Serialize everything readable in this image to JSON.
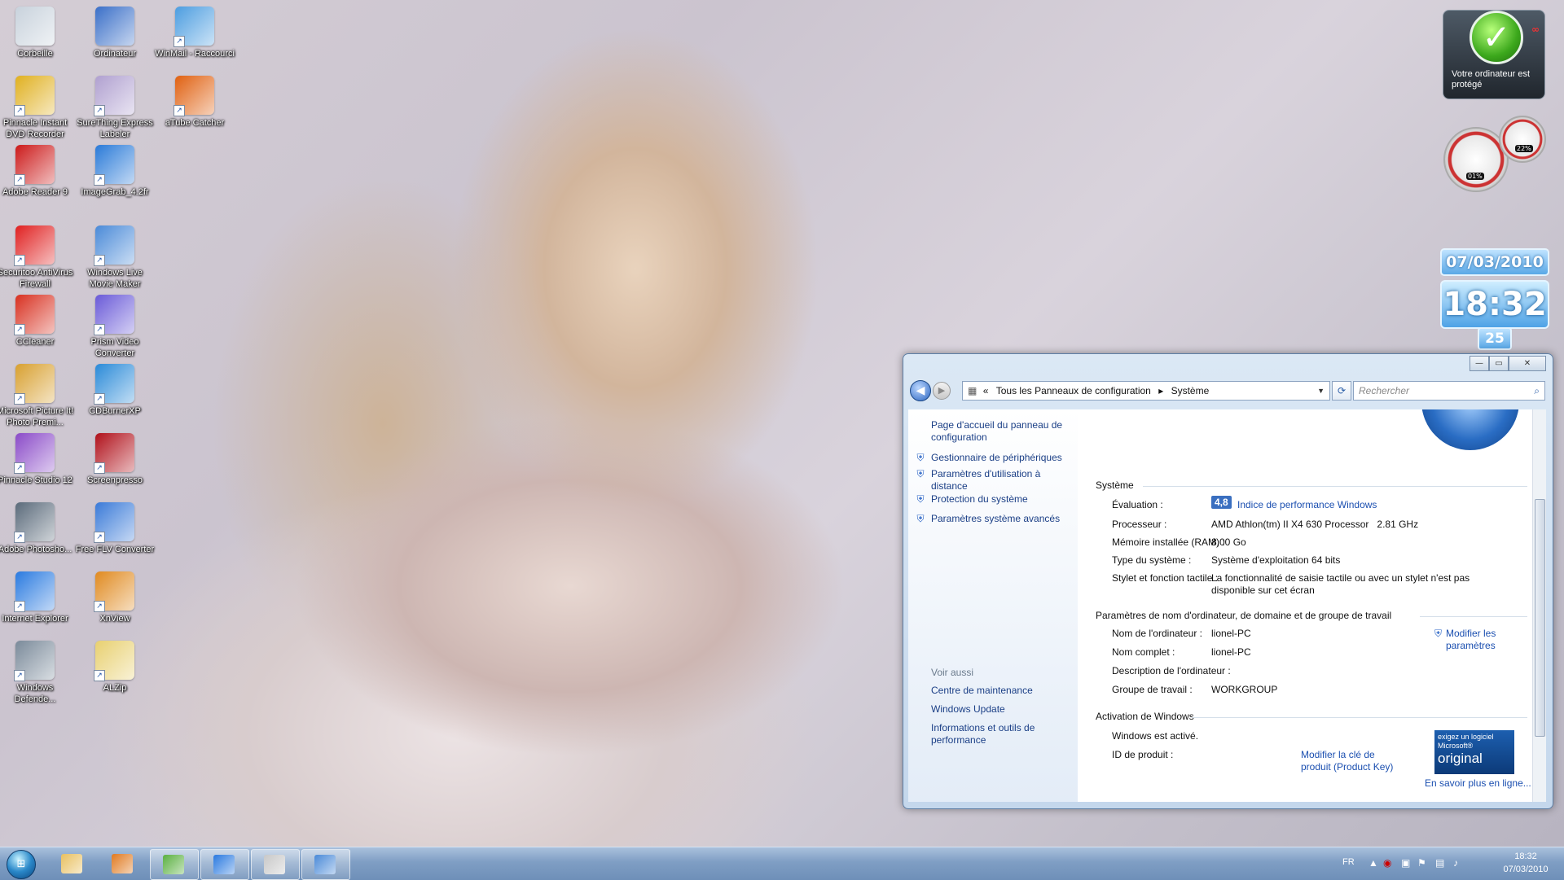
{
  "desktop_icons": [
    {
      "label": "Corbeille",
      "color": "#c8d2dc"
    },
    {
      "label": "Ordinateur",
      "color": "#3a6fc8"
    },
    {
      "label": "WinMail - Raccourci",
      "color": "#4c9de0"
    },
    {
      "label": "Pinnacle Instant DVD Recorder",
      "color": "#e0b020"
    },
    {
      "label": "SureThing Express Labeler",
      "color": "#b0a0d0"
    },
    {
      "label": "aTube Catcher",
      "color": "#e06010"
    },
    {
      "label": "Adobe Reader 9",
      "color": "#cc1a1a"
    },
    {
      "label": "ImageGrab_4.2fr",
      "color": "#2a7ad8"
    },
    {
      "label": "Securitoo AntiVirus Firewall",
      "color": "#e02020"
    },
    {
      "label": "Windows Live Movie Maker",
      "color": "#4a8ad8"
    },
    {
      "label": "CCleaner",
      "color": "#d83020"
    },
    {
      "label": "Prism Video Converter",
      "color": "#6a5ad8"
    },
    {
      "label": "Microsoft Picture It! Photo Premi...",
      "color": "#d8a030"
    },
    {
      "label": "CDBurnerXP",
      "color": "#2a8ad8"
    },
    {
      "label": "Pinnacle Studio 12",
      "color": "#8a4ac8"
    },
    {
      "label": "Screenpresso",
      "color": "#b0101a"
    },
    {
      "label": "Adobe Photosho...",
      "color": "#5a6a7a"
    },
    {
      "label": "Free FLV Converter",
      "color": "#3a7ad8"
    },
    {
      "label": "Internet Explorer",
      "color": "#2a7ae0"
    },
    {
      "label": "XnView",
      "color": "#e08a20"
    },
    {
      "label": "Windows Defende...",
      "color": "#7a8a9a"
    },
    {
      "label": "ALZip",
      "color": "#e8d070"
    }
  ],
  "gadgets": {
    "security": {
      "text": "Votre ordinateur est protégé",
      "check": "✓",
      "inf": "∞"
    },
    "meter": {
      "cpu": "01%",
      "ram": "22%"
    },
    "date": "07/03/2010",
    "time": "18:32",
    "day": "25"
  },
  "window": {
    "buttons": {
      "min": "—",
      "max": "▭",
      "close": "✕"
    },
    "breadcrumb": {
      "sep": "«",
      "part1": "Tous les Panneaux de configuration",
      "arrow": "▸",
      "part2": "Système"
    },
    "search_placeholder": "Rechercher",
    "sidebar": {
      "home": "Page d'accueil du panneau de configuration",
      "links": [
        "Gestionnaire de périphériques",
        "Paramètres d'utilisation à distance",
        "Protection du système",
        "Paramètres système avancés"
      ],
      "see_also_title": "Voir aussi",
      "see_also": [
        "Centre de maintenance",
        "Windows Update",
        "Informations et outils de performance"
      ]
    },
    "system": {
      "title": "Système",
      "rating_label": "Évaluation :",
      "rating_value": "4,8",
      "rating_link": "Indice de performance Windows",
      "proc_label": "Processeur :",
      "proc_value": "AMD Athlon(tm) II X4 630 Processor   2.81 GHz",
      "ram_label": "Mémoire installée (RAM) :",
      "ram_value": "8,00 Go",
      "type_label": "Type du système :",
      "type_value": "Système d'exploitation 64 bits",
      "pen_label": "Stylet et fonction tactile :",
      "pen_value": "La fonctionnalité de saisie tactile ou avec un stylet n'est pas disponible sur cet écran"
    },
    "computer": {
      "title": "Paramètres de nom d'ordinateur, de domaine et de groupe de travail",
      "name_label": "Nom de l'ordinateur :",
      "name_value": "lionel-PC",
      "full_label": "Nom complet :",
      "full_value": "lionel-PC",
      "desc_label": "Description de l'ordinateur :",
      "group_label": "Groupe de travail :",
      "group_value": "WORKGROUP",
      "modify": "Modifier les paramètres"
    },
    "activation": {
      "title": "Activation de Windows",
      "status": "Windows est activé.",
      "id_label": "ID de produit :",
      "key_link": "Modifier la clé de produit (Product Key)",
      "badge_line1": "exigez un logiciel",
      "badge_line2": "Microsoft®",
      "badge_line3": "original",
      "learn_more": "En savoir plus en ligne..."
    }
  },
  "taskbar": {
    "lang": "FR",
    "time": "18:32",
    "date": "07/03/2010",
    "items": [
      {
        "name": "explorer",
        "color": "#e8c060",
        "active": false
      },
      {
        "name": "media",
        "color": "#e07a20",
        "active": false
      },
      {
        "name": "messenger",
        "color": "#5ab040",
        "active": true
      },
      {
        "name": "ie",
        "color": "#2a7ae0",
        "active": true
      },
      {
        "name": "app",
        "color": "#c8c8c8",
        "active": true
      },
      {
        "name": "control-panel",
        "color": "#4a8ad8",
        "active": true
      }
    ]
  }
}
